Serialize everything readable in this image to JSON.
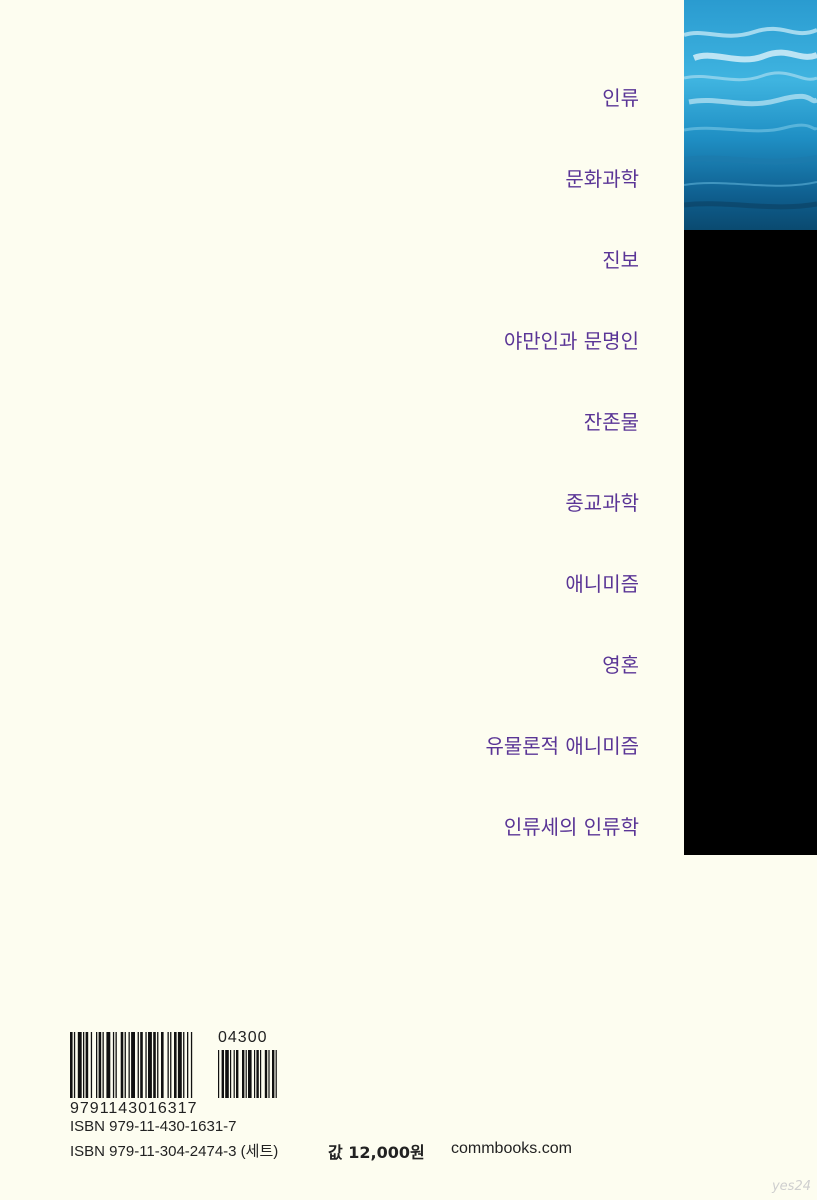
{
  "back_cover": {
    "keywords": [
      "인류",
      "문화과학",
      "진보",
      "야만인과 문명인",
      "잔존물",
      "종교과학",
      "애니미즘",
      "영혼",
      "유물론적 애니미즘",
      "인류세의 인류학"
    ],
    "keyword_color": "#5a3596",
    "background_color": "#fdfdf0",
    "spine_color": "#000000"
  },
  "barcode": {
    "ean_digits": "9791143016317",
    "addon_digits": "04300"
  },
  "isbn": {
    "line1": "ISBN 979-11-430-1631-7",
    "line2": "ISBN 979-11-304-2474-3 (세트)"
  },
  "price": "값 12,000원",
  "publisher_site": "commbooks.com",
  "watermark": "yes24"
}
